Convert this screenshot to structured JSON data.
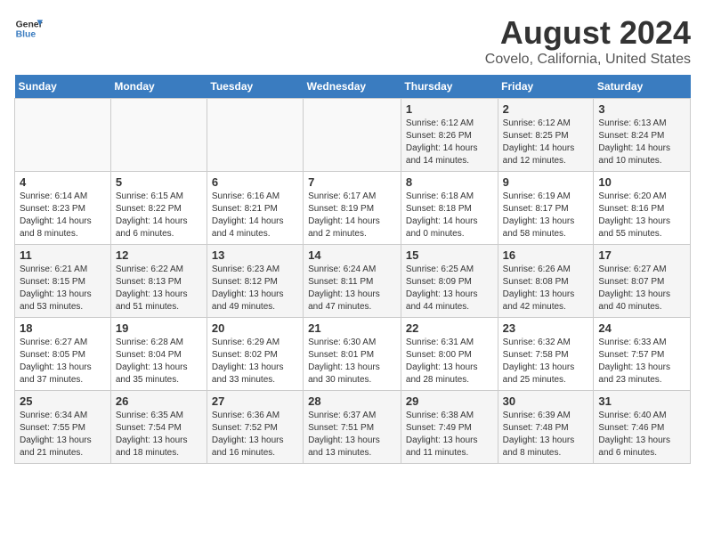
{
  "logo": {
    "line1": "General",
    "line2": "Blue"
  },
  "title": "August 2024",
  "subtitle": "Covelo, California, United States",
  "days_of_week": [
    "Sunday",
    "Monday",
    "Tuesday",
    "Wednesday",
    "Thursday",
    "Friday",
    "Saturday"
  ],
  "weeks": [
    [
      {
        "day": "",
        "info": ""
      },
      {
        "day": "",
        "info": ""
      },
      {
        "day": "",
        "info": ""
      },
      {
        "day": "",
        "info": ""
      },
      {
        "day": "1",
        "info": "Sunrise: 6:12 AM\nSunset: 8:26 PM\nDaylight: 14 hours\nand 14 minutes."
      },
      {
        "day": "2",
        "info": "Sunrise: 6:12 AM\nSunset: 8:25 PM\nDaylight: 14 hours\nand 12 minutes."
      },
      {
        "day": "3",
        "info": "Sunrise: 6:13 AM\nSunset: 8:24 PM\nDaylight: 14 hours\nand 10 minutes."
      }
    ],
    [
      {
        "day": "4",
        "info": "Sunrise: 6:14 AM\nSunset: 8:23 PM\nDaylight: 14 hours\nand 8 minutes."
      },
      {
        "day": "5",
        "info": "Sunrise: 6:15 AM\nSunset: 8:22 PM\nDaylight: 14 hours\nand 6 minutes."
      },
      {
        "day": "6",
        "info": "Sunrise: 6:16 AM\nSunset: 8:21 PM\nDaylight: 14 hours\nand 4 minutes."
      },
      {
        "day": "7",
        "info": "Sunrise: 6:17 AM\nSunset: 8:19 PM\nDaylight: 14 hours\nand 2 minutes."
      },
      {
        "day": "8",
        "info": "Sunrise: 6:18 AM\nSunset: 8:18 PM\nDaylight: 14 hours\nand 0 minutes."
      },
      {
        "day": "9",
        "info": "Sunrise: 6:19 AM\nSunset: 8:17 PM\nDaylight: 13 hours\nand 58 minutes."
      },
      {
        "day": "10",
        "info": "Sunrise: 6:20 AM\nSunset: 8:16 PM\nDaylight: 13 hours\nand 55 minutes."
      }
    ],
    [
      {
        "day": "11",
        "info": "Sunrise: 6:21 AM\nSunset: 8:15 PM\nDaylight: 13 hours\nand 53 minutes."
      },
      {
        "day": "12",
        "info": "Sunrise: 6:22 AM\nSunset: 8:13 PM\nDaylight: 13 hours\nand 51 minutes."
      },
      {
        "day": "13",
        "info": "Sunrise: 6:23 AM\nSunset: 8:12 PM\nDaylight: 13 hours\nand 49 minutes."
      },
      {
        "day": "14",
        "info": "Sunrise: 6:24 AM\nSunset: 8:11 PM\nDaylight: 13 hours\nand 47 minutes."
      },
      {
        "day": "15",
        "info": "Sunrise: 6:25 AM\nSunset: 8:09 PM\nDaylight: 13 hours\nand 44 minutes."
      },
      {
        "day": "16",
        "info": "Sunrise: 6:26 AM\nSunset: 8:08 PM\nDaylight: 13 hours\nand 42 minutes."
      },
      {
        "day": "17",
        "info": "Sunrise: 6:27 AM\nSunset: 8:07 PM\nDaylight: 13 hours\nand 40 minutes."
      }
    ],
    [
      {
        "day": "18",
        "info": "Sunrise: 6:27 AM\nSunset: 8:05 PM\nDaylight: 13 hours\nand 37 minutes."
      },
      {
        "day": "19",
        "info": "Sunrise: 6:28 AM\nSunset: 8:04 PM\nDaylight: 13 hours\nand 35 minutes."
      },
      {
        "day": "20",
        "info": "Sunrise: 6:29 AM\nSunset: 8:02 PM\nDaylight: 13 hours\nand 33 minutes."
      },
      {
        "day": "21",
        "info": "Sunrise: 6:30 AM\nSunset: 8:01 PM\nDaylight: 13 hours\nand 30 minutes."
      },
      {
        "day": "22",
        "info": "Sunrise: 6:31 AM\nSunset: 8:00 PM\nDaylight: 13 hours\nand 28 minutes."
      },
      {
        "day": "23",
        "info": "Sunrise: 6:32 AM\nSunset: 7:58 PM\nDaylight: 13 hours\nand 25 minutes."
      },
      {
        "day": "24",
        "info": "Sunrise: 6:33 AM\nSunset: 7:57 PM\nDaylight: 13 hours\nand 23 minutes."
      }
    ],
    [
      {
        "day": "25",
        "info": "Sunrise: 6:34 AM\nSunset: 7:55 PM\nDaylight: 13 hours\nand 21 minutes."
      },
      {
        "day": "26",
        "info": "Sunrise: 6:35 AM\nSunset: 7:54 PM\nDaylight: 13 hours\nand 18 minutes."
      },
      {
        "day": "27",
        "info": "Sunrise: 6:36 AM\nSunset: 7:52 PM\nDaylight: 13 hours\nand 16 minutes."
      },
      {
        "day": "28",
        "info": "Sunrise: 6:37 AM\nSunset: 7:51 PM\nDaylight: 13 hours\nand 13 minutes."
      },
      {
        "day": "29",
        "info": "Sunrise: 6:38 AM\nSunset: 7:49 PM\nDaylight: 13 hours\nand 11 minutes."
      },
      {
        "day": "30",
        "info": "Sunrise: 6:39 AM\nSunset: 7:48 PM\nDaylight: 13 hours\nand 8 minutes."
      },
      {
        "day": "31",
        "info": "Sunrise: 6:40 AM\nSunset: 7:46 PM\nDaylight: 13 hours\nand 6 minutes."
      }
    ]
  ]
}
